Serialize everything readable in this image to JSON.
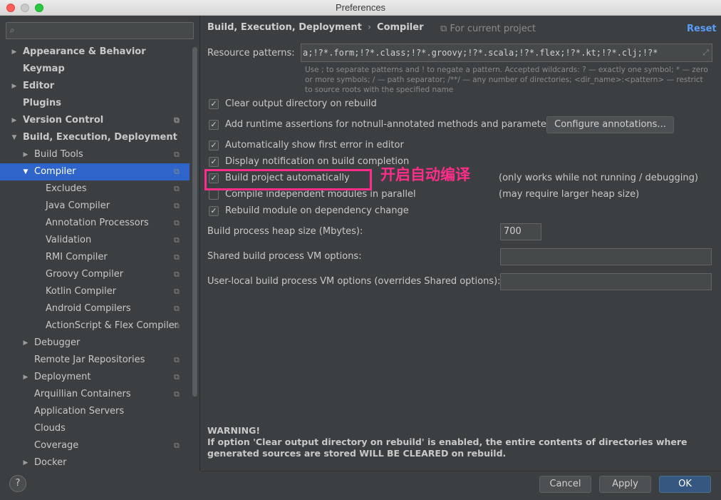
{
  "window": {
    "title": "Preferences"
  },
  "sidebar": {
    "search_placeholder": "",
    "items": [
      {
        "label": "Appearance & Behavior",
        "bold": true,
        "arrow": "▶",
        "level": 0
      },
      {
        "label": "Keymap",
        "bold": true,
        "arrow": "",
        "level": 0
      },
      {
        "label": "Editor",
        "bold": true,
        "arrow": "▶",
        "level": 0
      },
      {
        "label": "Plugins",
        "bold": true,
        "arrow": "",
        "level": 0
      },
      {
        "label": "Version Control",
        "bold": true,
        "arrow": "▶",
        "level": 0,
        "proj": true
      },
      {
        "label": "Build, Execution, Deployment",
        "bold": true,
        "arrow": "▼",
        "level": 0
      },
      {
        "label": "Build Tools",
        "arrow": "▶",
        "level": 1,
        "proj": true
      },
      {
        "label": "Compiler",
        "arrow": "▼",
        "level": 1,
        "proj": true,
        "selected": true
      },
      {
        "label": "Excludes",
        "arrow": "",
        "level": 2,
        "proj": true
      },
      {
        "label": "Java Compiler",
        "arrow": "",
        "level": 2,
        "proj": true
      },
      {
        "label": "Annotation Processors",
        "arrow": "",
        "level": 2,
        "proj": true
      },
      {
        "label": "Validation",
        "arrow": "",
        "level": 2,
        "proj": true
      },
      {
        "label": "RMI Compiler",
        "arrow": "",
        "level": 2,
        "proj": true
      },
      {
        "label": "Groovy Compiler",
        "arrow": "",
        "level": 2,
        "proj": true
      },
      {
        "label": "Kotlin Compiler",
        "arrow": "",
        "level": 2,
        "proj": true
      },
      {
        "label": "Android Compilers",
        "arrow": "",
        "level": 2,
        "proj": true
      },
      {
        "label": "ActionScript & Flex Compiler",
        "arrow": "",
        "level": 2,
        "proj": true
      },
      {
        "label": "Debugger",
        "arrow": "▶",
        "level": 1
      },
      {
        "label": "Remote Jar Repositories",
        "arrow": "",
        "level": 1,
        "proj": true
      },
      {
        "label": "Deployment",
        "arrow": "▶",
        "level": 1,
        "proj": true
      },
      {
        "label": "Arquillian Containers",
        "arrow": "",
        "level": 1,
        "proj": true
      },
      {
        "label": "Application Servers",
        "arrow": "",
        "level": 1
      },
      {
        "label": "Clouds",
        "arrow": "",
        "level": 1
      },
      {
        "label": "Coverage",
        "arrow": "",
        "level": 1,
        "proj": true
      },
      {
        "label": "Docker",
        "arrow": "▶",
        "level": 1
      }
    ],
    "help_label": "?"
  },
  "main": {
    "breadcrumb": {
      "section": "Build, Execution, Deployment",
      "separator": "›",
      "page": "Compiler"
    },
    "scope_label": "For current project",
    "reset_label": "Reset",
    "resource_patterns": {
      "label": "Resource patterns:",
      "value": "a;!?*.form;!?*.class;!?*.groovy;!?*.scala;!?*.flex;!?*.kt;!?*.clj;!?*",
      "hint": "Use ; to separate patterns and ! to negate a pattern. Accepted wildcards: ? — exactly one symbol; * — zero or more symbols; / — path separator; /**/ — any number of directories; <dir_name>:<pattern> — restrict to source roots with the specified name"
    },
    "options": {
      "clear_output": {
        "label": "Clear output directory on rebuild",
        "checked": true
      },
      "runtime_assertions": {
        "label": "Add runtime assertions for notnull-annotated methods and parameters",
        "checked": true
      },
      "configure_annotations": "Configure annotations...",
      "show_first_error": {
        "label": "Automatically show first error in editor",
        "checked": true
      },
      "display_notification": {
        "label": "Display notification on build completion",
        "checked": true
      },
      "build_auto": {
        "label": "Build project automatically",
        "checked": true,
        "note": "(only works while not running / debugging)"
      },
      "compile_parallel": {
        "label": "Compile independent modules in parallel",
        "checked": false,
        "note": "(may require larger heap size)"
      },
      "rebuild_on_dependency": {
        "label": "Rebuild module on dependency change",
        "checked": true
      }
    },
    "heap_size": {
      "label": "Build process heap size (Mbytes):",
      "value": "700"
    },
    "shared_vm": {
      "label": "Shared build process VM options:",
      "value": ""
    },
    "user_vm": {
      "label": "User-local build process VM options (overrides Shared options):",
      "value": ""
    },
    "annotation": "开启自动编译",
    "warning": {
      "title": "WARNING!",
      "text": "If option 'Clear output directory on rebuild' is enabled, the entire contents of directories where generated sources are stored WILL BE CLEARED on rebuild."
    }
  },
  "footer": {
    "cancel": "Cancel",
    "apply": "Apply",
    "ok": "OK"
  },
  "icons": {
    "check": "✓",
    "search": "⌕",
    "expand": "⤢",
    "project_scope": "⧉"
  },
  "colors": {
    "selection": "#2f65ca",
    "accent_link": "#589df6",
    "annotation": "#ff2d8a",
    "primary_button": "#365880"
  }
}
